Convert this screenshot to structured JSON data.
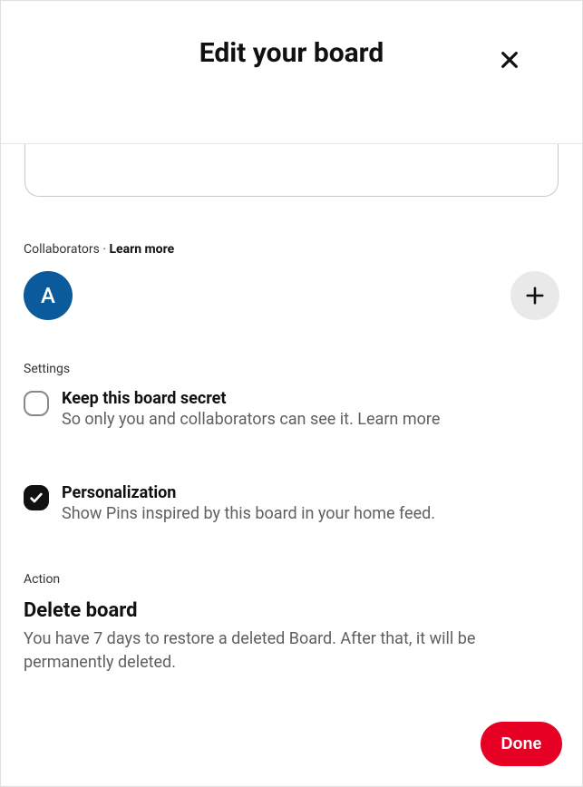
{
  "header": {
    "title": "Edit your board"
  },
  "collaborators": {
    "label": "Collaborators",
    "separator": " · ",
    "learn_more": "Learn more",
    "avatar_initial": "A"
  },
  "settings": {
    "label": "Settings",
    "secret": {
      "title": "Keep this board secret",
      "desc": "So only you and collaborators can see it. ",
      "learn_more": "Learn more",
      "checked": false
    },
    "personalization": {
      "title": "Personalization",
      "desc": "Show Pins inspired by this board in your home feed.",
      "checked": true
    }
  },
  "action": {
    "label": "Action",
    "delete_title": "Delete board",
    "delete_desc": "You have 7 days to restore a deleted Board. After that, it will be permanently deleted."
  },
  "footer": {
    "done": "Done"
  }
}
